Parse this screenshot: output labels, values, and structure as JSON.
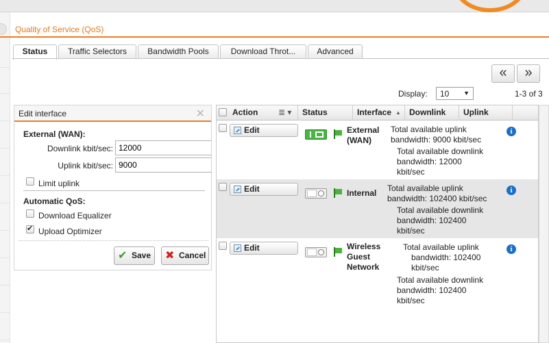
{
  "page": {
    "title": "Quality of Service (QoS)"
  },
  "tabs": [
    {
      "label": "Status",
      "active": true
    },
    {
      "label": "Traffic Selectors"
    },
    {
      "label": "Bandwidth Pools"
    },
    {
      "label": "Download Throt..."
    },
    {
      "label": "Advanced"
    }
  ],
  "pager": {
    "prev_symbol": "«",
    "next_symbol": "»",
    "display_label": "Display:",
    "display_value": "10",
    "display_arrow": "▼",
    "count_text": "1-3 of 3"
  },
  "edit_panel": {
    "title": "Edit interface",
    "close_symbol": "✕",
    "section_interface": "External (WAN):",
    "downlink_label": "Downlink kbit/sec:",
    "downlink_value": "12000",
    "uplink_label": "Uplink kbit/sec:",
    "uplink_value": "9000",
    "limit_uplink_label": "Limit uplink",
    "limit_uplink_checked": false,
    "section_auto": "Automatic QoS:",
    "download_equalizer_label": "Download Equalizer",
    "download_equalizer_checked": false,
    "upload_optimizer_label": "Upload Optimizer",
    "upload_optimizer_checked": true,
    "save_label": "Save",
    "save_icon": "✔",
    "cancel_label": "Cancel",
    "cancel_icon": "✖"
  },
  "grid": {
    "columns": {
      "action": "Action",
      "status": "Status",
      "interface": "Interface",
      "downlink": "Downlink",
      "uplink": "Uplink"
    },
    "sort_icon": "≣ ▾",
    "sort_asc_icon": "▲",
    "rows": [
      {
        "edit_label": "Edit",
        "enabled": true,
        "name_lines": [
          "External",
          "(WAN)"
        ],
        "uplink_lines": [
          "Total available uplink",
          "bandwidth: 9000 kbit/sec"
        ],
        "downlink_lines": [
          "Total available downlink",
          "bandwidth: 12000",
          "kbit/sec"
        ],
        "info_symbol": "i"
      },
      {
        "edit_label": "Edit",
        "enabled": false,
        "name_lines": [
          "Internal"
        ],
        "uplink_lines": [
          "Total available uplink",
          "bandwidth: 102400 kbit/sec"
        ],
        "downlink_lines": [
          "Total available downlink",
          "bandwidth: 102400",
          "kbit/sec"
        ],
        "info_symbol": "i"
      },
      {
        "edit_label": "Edit",
        "enabled": false,
        "name_lines": [
          "Wireless",
          "Guest",
          "Network"
        ],
        "uplink_lines": [
          "Total available uplink",
          "bandwidth: 102400",
          "kbit/sec"
        ],
        "downlink_lines": [
          "Total available downlink",
          "bandwidth: 102400",
          "kbit/sec"
        ],
        "info_symbol": "i"
      }
    ]
  }
}
